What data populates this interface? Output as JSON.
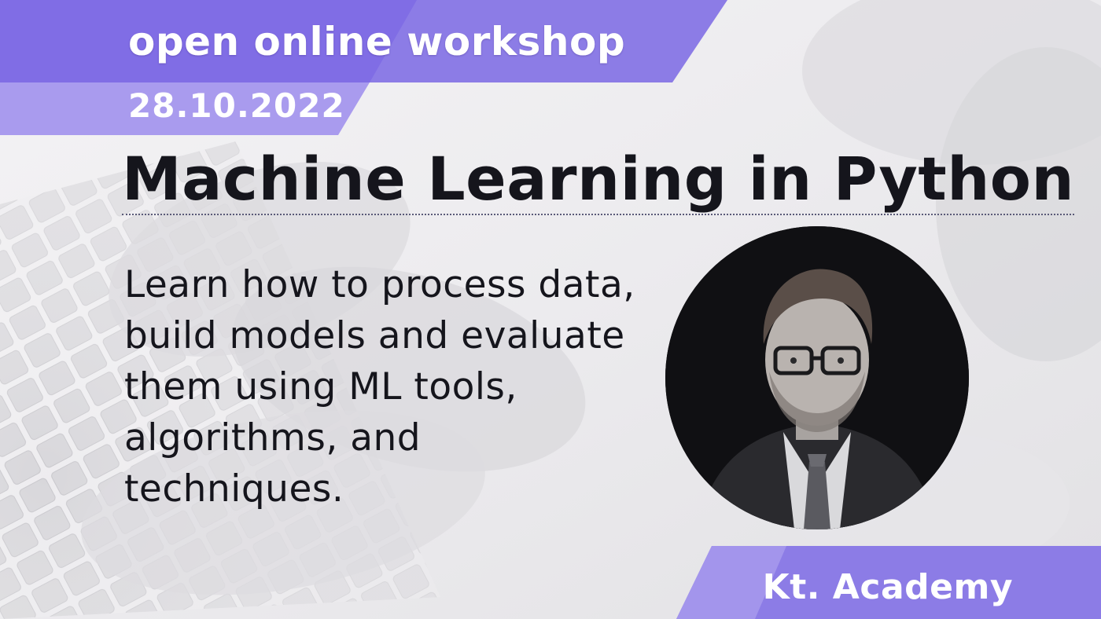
{
  "banner": {
    "workshop_label": "open online workshop",
    "date": "28.10.2022"
  },
  "title": "Machine Learning in Python",
  "description": "Learn how to process data, build models and evaluate them using ML tools, algorithms, and techniques.",
  "brand": "Kt. Academy",
  "colors": {
    "banner_purple": "#8c7ce6",
    "banner_light": "#b4aaf0",
    "title_text": "#15151c"
  }
}
